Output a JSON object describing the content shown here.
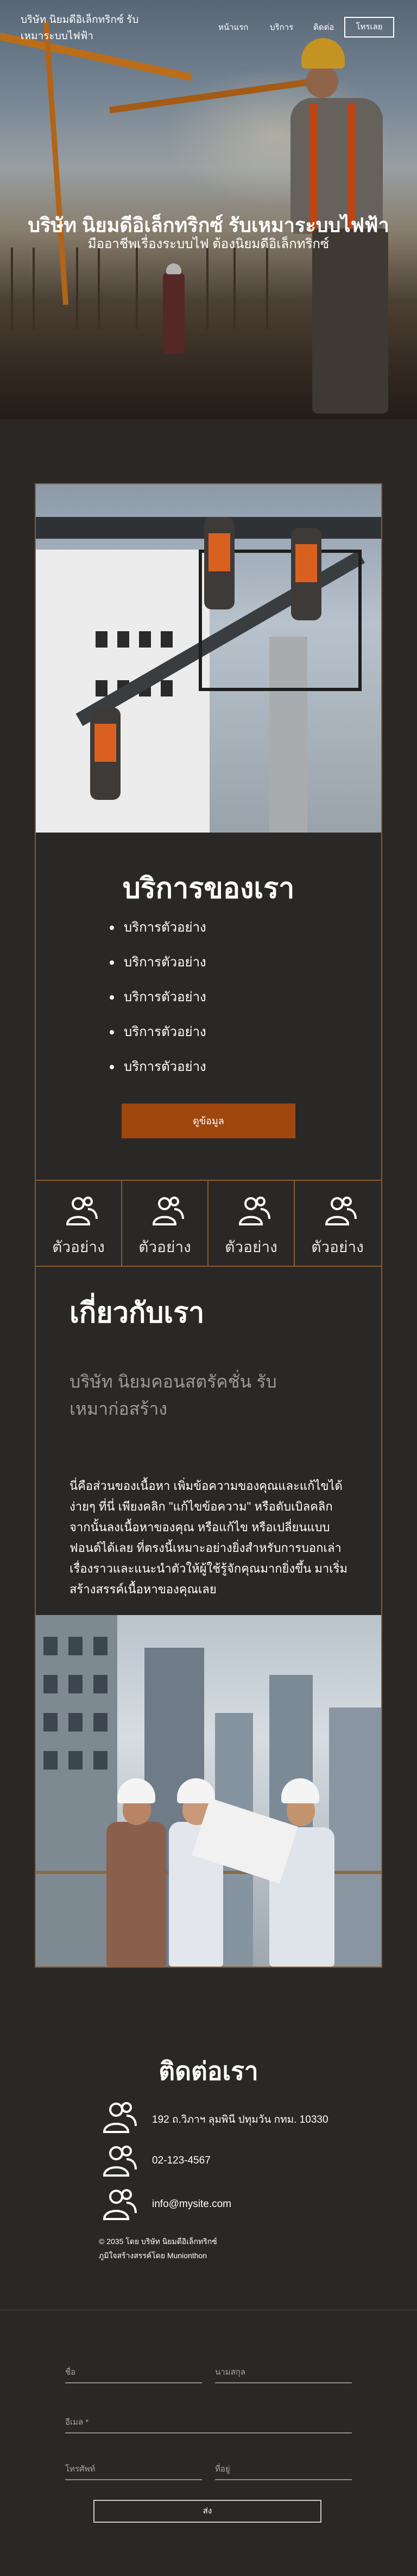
{
  "header": {
    "brand": "บริษัท นิยมดีอิเล็กทริกซ์ รับเหมาระบบไฟฟ้า",
    "nav": [
      "หน้าแรก",
      "บริการ",
      "ติดต่อ"
    ],
    "login_label": "โทรเลย"
  },
  "hero": {
    "title": "บริษัท นิยมดีอิเล็กทริกซ์ รับเหมาระบบไฟฟ้า",
    "subtitle": "มืออาชีพเรื่องระบบไฟ ต้องนิยมดีอิเล็กทริกซ์"
  },
  "services": {
    "title": "บริการของเรา",
    "items": [
      "บริการตัวอย่าง",
      "บริการตัวอย่าง",
      "บริการตัวอย่าง",
      "บริการตัวอย่าง",
      "บริการตัวอย่าง"
    ],
    "button_label": "ดูข้อมูล"
  },
  "features": [
    {
      "icon": "people-icon",
      "label": "ตัวอย่าง"
    },
    {
      "icon": "people-icon",
      "label": "ตัวอย่าง"
    },
    {
      "icon": "people-icon",
      "label": "ตัวอย่าง"
    },
    {
      "icon": "people-icon",
      "label": "ตัวอย่าง"
    }
  ],
  "about": {
    "title": "เกี่ยวกับเรา",
    "company": "บริษัท นิยมคอนสตรัคชั่น รับเหมาก่อสร้าง",
    "body": "นี่คือส่วนของเนื้อหา เพิ่มข้อความของคุณและแก้ไขได้ง่ายๆ ที่นี่ เพียงคลิก \"แก้ไขข้อความ\" หรือดับเบิลคลิกจากนั้นลงเนื้อหาของคุณ หรือแก้ไข หรือเปลี่ยนแบบฟอนต์ได้เลย ที่ตรงนี้เหมาะอย่างยิ่งสำหรับการบอกเล่าเรื่องราวและแนะนำตัวให้ผู้ใช้รู้จักคุณมากยิ่งขึ้น มาเริ่มสร้างสรรค์เนื้อหาของคุณเลย"
  },
  "contact": {
    "title": "ติดต่อเรา",
    "address": "192 ถ.วิภาฯ ลุมพินี ปทุมวัน กทม. 10330",
    "phone": "02-123-4567",
    "email": "info@mysite.com",
    "copyright_line1": "© 2035 โดย บริษัท นิยมดีอิเล็กทริกซ์",
    "copyright_line2": "ภูมิใจสร้างสรรค์โดย Munionthon"
  },
  "form": {
    "first_name_placeholder": "ชื่อ",
    "last_name_placeholder": "นามสกุล",
    "email_placeholder": "อีเมล *",
    "phone_placeholder": "โทรศัพท์",
    "address_placeholder": "ที่อยู่",
    "submit_label": "ส่ง"
  },
  "colors": {
    "background": "#2a2826",
    "accent": "#a0470f",
    "border": "#8b5a2b"
  }
}
